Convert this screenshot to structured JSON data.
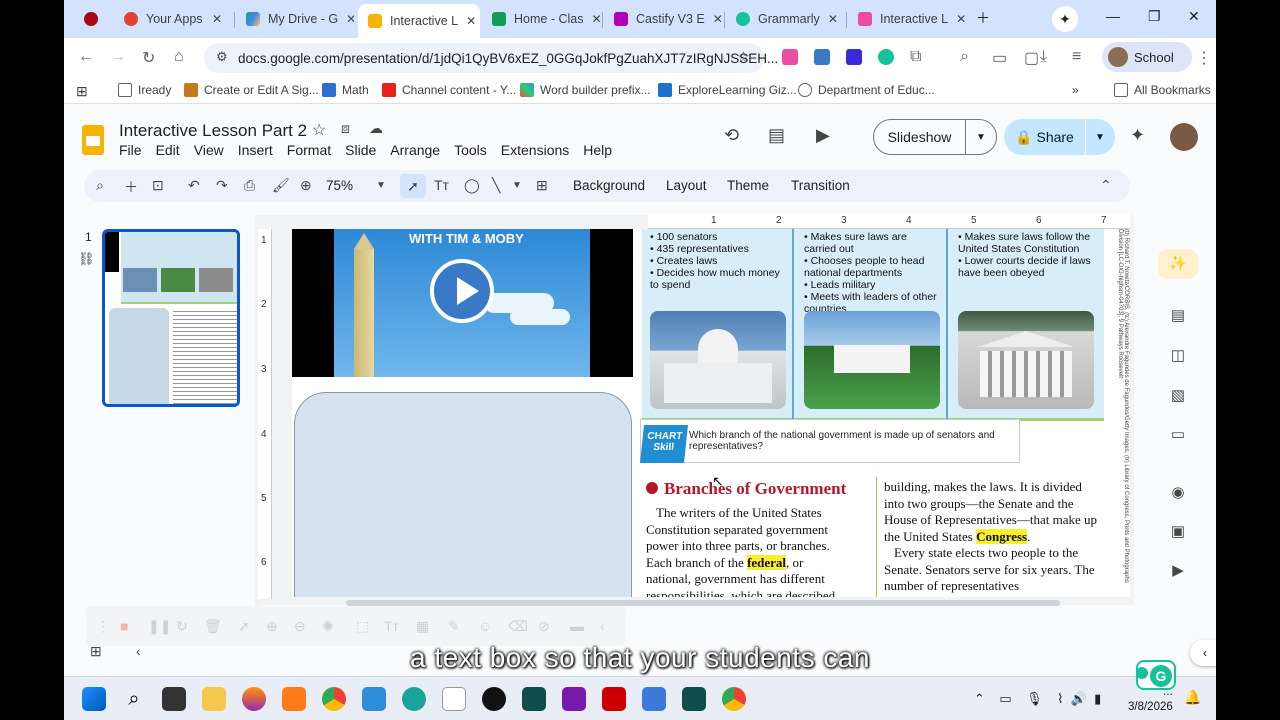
{
  "browser": {
    "tabs": [
      {
        "label": "Your Apps",
        "color": "#e34133"
      },
      {
        "label": "My Drive - G",
        "color": "#1fa463"
      },
      {
        "label": "Interactive L",
        "color": "#f4b400",
        "active": true
      },
      {
        "label": "Home - Clas",
        "color": "#0f9d58"
      },
      {
        "label": "Castify V3 E",
        "color": "#b000b8"
      },
      {
        "label": "Grammarly",
        "color": "#15c39a"
      },
      {
        "label": "Interactive L",
        "color": "#e94f9e"
      }
    ],
    "url": "docs.google.com/presentation/d/1jdQi1QyBV6xEZ_0GGqJokfPgZuahXJT7zIRgNJSSEH...",
    "profile_label": "School",
    "bookmarks": [
      "Iready",
      "Create or Edit A Sig...",
      "Math",
      "Channel content - Y...",
      "Word builder prefix...",
      "ExploreLearning Giz...",
      "Department of Educ..."
    ],
    "all_bookmarks": "All Bookmarks"
  },
  "docs": {
    "title": "Interactive Lesson Part 2",
    "menu": [
      "File",
      "Edit",
      "View",
      "Insert",
      "Format",
      "Slide",
      "Arrange",
      "Tools",
      "Extensions",
      "Help"
    ],
    "slideshow_label": "Slideshow",
    "share_label": "Share",
    "zoom": "75%",
    "toolbar_text": [
      "Background",
      "Layout",
      "Theme",
      "Transition"
    ],
    "slide_number": "1"
  },
  "slide": {
    "video_title": "WITH TIM & MOBY",
    "columns": [
      {
        "bullets": [
          "100 senators",
          "435 representatives",
          "Creates laws",
          "Decides how much money to spend"
        ]
      },
      {
        "bullets": [
          "Makes sure laws are carried out",
          "Chooses people to head national departments",
          "Leads military",
          "Meets with leaders of other countries"
        ]
      },
      {
        "bullets": [
          "Makes sure laws follow the United States Constitution",
          "Lower courts decide if laws have been obeyed"
        ]
      }
    ],
    "chart_skill": "CHART Skill",
    "chart_question": "Which branch of the national government is made up of senators and representatives?",
    "section_heading": "Branches of Government",
    "para1_a": "The writers of the United States Constitution separated government power into three parts, or branches. Each branch of the ",
    "para1_hl": "federal",
    "para1_b": ", or national, government has different responsibilities, which are described",
    "para2_a": "building, makes the laws. It is divided into two groups—the Senate and the House of Representatives—that make up the United States ",
    "para2_hl": "Congress",
    "para2_b": ".",
    "para3": "Every state elects two people to the Senate. Senators serve for six years. The number of representatives",
    "credit": "(tl) Richard T. Nowitz/CORBIS, (tc) Alexandre Fagundes de Fagundes/Getty Images, (tr) Library of Congress, Prints and Photographs Division [LC-DIG-highsm-04703]; 9 Pathways Roosevelt"
  },
  "caption": "a text box so that your students can",
  "clock": {
    "time": "...",
    "date": "3/8/2026"
  }
}
